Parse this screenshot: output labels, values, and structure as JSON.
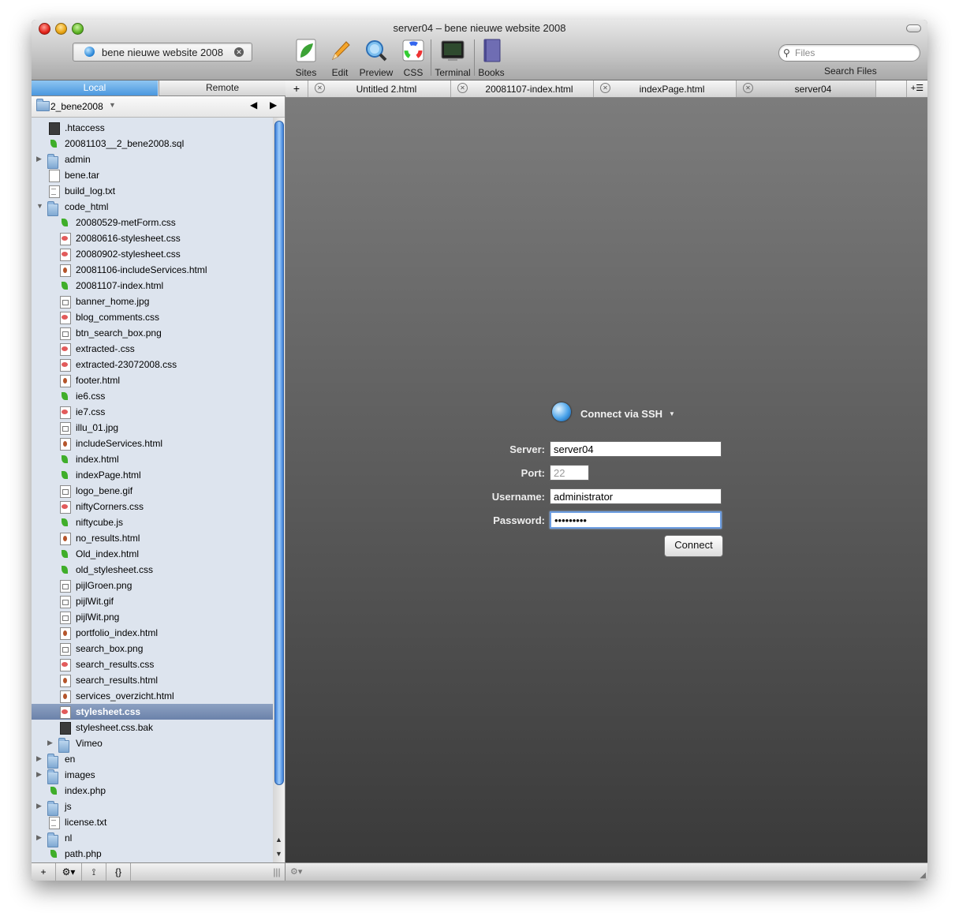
{
  "window": {
    "title": "server04 – bene nieuwe website 2008"
  },
  "toolbar": {
    "site_name": "bene nieuwe website 2008",
    "buttons": [
      {
        "label": "Sites",
        "icon": "sites-leaf-icon"
      },
      {
        "label": "Edit",
        "icon": "pencil-icon"
      },
      {
        "label": "Preview",
        "icon": "magnifier-globe-icon"
      },
      {
        "label": "CSS",
        "icon": "color-wheel-icon"
      },
      {
        "label": "Terminal",
        "icon": "terminal-icon"
      },
      {
        "label": "Books",
        "icon": "book-icon"
      }
    ],
    "search_placeholder": "Files",
    "search_label": "Search Files"
  },
  "sidebar": {
    "segments": {
      "local": "Local",
      "remote": "Remote"
    },
    "path": "2_bene2008",
    "files": [
      {
        "name": ".htaccess",
        "kind": "dark",
        "level": 0
      },
      {
        "name": "20081103__2_bene2008.sql",
        "kind": "leafonly",
        "level": 0
      },
      {
        "name": "admin",
        "kind": "folder",
        "level": 0,
        "collapsed": true
      },
      {
        "name": "bene.tar",
        "kind": "doc",
        "level": 0
      },
      {
        "name": "build_log.txt",
        "kind": "txt",
        "level": 0
      },
      {
        "name": "code_html",
        "kind": "folder",
        "level": 0,
        "expanded": true
      },
      {
        "name": "20080529-metForm.css",
        "kind": "leafonly",
        "level": 1
      },
      {
        "name": "20080616-stylesheet.css",
        "kind": "css",
        "level": 1
      },
      {
        "name": "20080902-stylesheet.css",
        "kind": "css",
        "level": 1
      },
      {
        "name": "20081106-includeServices.html",
        "kind": "seed",
        "level": 1
      },
      {
        "name": "20081107-index.html",
        "kind": "leafonly",
        "level": 1
      },
      {
        "name": "banner_home.jpg",
        "kind": "img",
        "level": 1
      },
      {
        "name": "blog_comments.css",
        "kind": "css",
        "level": 1
      },
      {
        "name": "btn_search_box.png",
        "kind": "img",
        "level": 1
      },
      {
        "name": "extracted-.css",
        "kind": "css",
        "level": 1
      },
      {
        "name": "extracted-23072008.css",
        "kind": "css",
        "level": 1
      },
      {
        "name": "footer.html",
        "kind": "seed",
        "level": 1
      },
      {
        "name": "ie6.css",
        "kind": "leafonly",
        "level": 1
      },
      {
        "name": "ie7.css",
        "kind": "css",
        "level": 1
      },
      {
        "name": "illu_01.jpg",
        "kind": "img",
        "level": 1
      },
      {
        "name": "includeServices.html",
        "kind": "seed",
        "level": 1
      },
      {
        "name": "index.html",
        "kind": "leafonly",
        "level": 1
      },
      {
        "name": "indexPage.html",
        "kind": "leafonly",
        "level": 1
      },
      {
        "name": "logo_bene.gif",
        "kind": "img",
        "level": 1
      },
      {
        "name": "niftyCorners.css",
        "kind": "css",
        "level": 1
      },
      {
        "name": "niftycube.js",
        "kind": "leafonly",
        "level": 1
      },
      {
        "name": "no_results.html",
        "kind": "seed",
        "level": 1
      },
      {
        "name": "Old_index.html",
        "kind": "leafonly",
        "level": 1
      },
      {
        "name": "old_stylesheet.css",
        "kind": "leafonly",
        "level": 1
      },
      {
        "name": "pijlGroen.png",
        "kind": "img",
        "level": 1
      },
      {
        "name": "pijlWit.gif",
        "kind": "img",
        "level": 1
      },
      {
        "name": "pijlWit.png",
        "kind": "img",
        "level": 1
      },
      {
        "name": "portfolio_index.html",
        "kind": "seed",
        "level": 1
      },
      {
        "name": "search_box.png",
        "kind": "img",
        "level": 1
      },
      {
        "name": "search_results.css",
        "kind": "css",
        "level": 1
      },
      {
        "name": "search_results.html",
        "kind": "seed",
        "level": 1
      },
      {
        "name": "services_overzicht.html",
        "kind": "seed",
        "level": 1
      },
      {
        "name": "stylesheet.css",
        "kind": "css",
        "level": 1,
        "selected": true
      },
      {
        "name": "stylesheet.css.bak",
        "kind": "dark",
        "level": 1
      },
      {
        "name": "Vimeo",
        "kind": "folder",
        "level": 1,
        "collapsed": true
      },
      {
        "name": "en",
        "kind": "folder",
        "level": 0,
        "collapsed": true
      },
      {
        "name": "images",
        "kind": "folder",
        "level": 0,
        "collapsed": true
      },
      {
        "name": "index.php",
        "kind": "leafonly",
        "level": 0
      },
      {
        "name": "js",
        "kind": "folder",
        "level": 0,
        "collapsed": true
      },
      {
        "name": "license.txt",
        "kind": "txt",
        "level": 0
      },
      {
        "name": "nl",
        "kind": "folder",
        "level": 0,
        "collapsed": true
      },
      {
        "name": "path.php",
        "kind": "leafonly",
        "level": 0
      }
    ]
  },
  "tabs": [
    {
      "label": "Untitled 2.html",
      "active": false
    },
    {
      "label": "20081107-index.html",
      "active": false
    },
    {
      "label": "indexPage.html",
      "active": false
    },
    {
      "label": "server04",
      "active": true
    }
  ],
  "ssh": {
    "title": "Connect via SSH",
    "server_label": "Server:",
    "server_value": "server04",
    "port_label": "Port:",
    "port_placeholder": "22",
    "username_label": "Username:",
    "username_value": "administrator",
    "password_label": "Password:",
    "password_value": "•••••••••",
    "connect_label": "Connect"
  },
  "bottombar": {
    "add": "+",
    "gear": "⚙▾",
    "rss": "⟟",
    "braces": "{}",
    "resize": "|||"
  }
}
